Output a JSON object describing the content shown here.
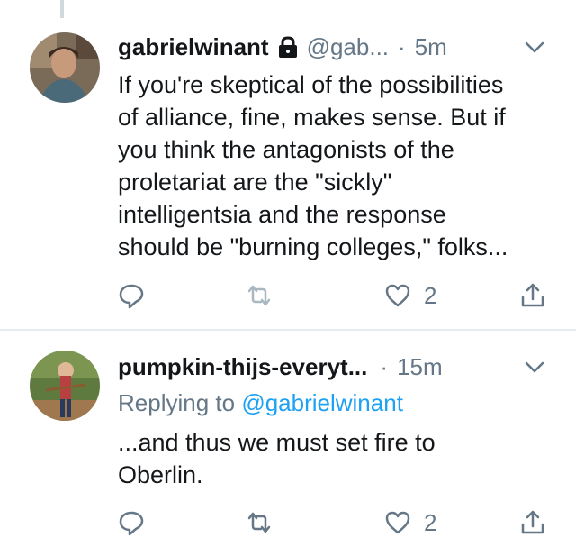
{
  "tweets": [
    {
      "display_name": "gabrielwinant",
      "handle": "@gab...",
      "separator": "·",
      "time": "5m",
      "body_lines": [
        "If you're skeptical of the possibilities",
        "of alliance, fine, makes sense. But if",
        "you think the antagonists of the",
        "proletariat are the \"sickly\"",
        "intelligentsia and the response",
        "should be \"burning colleges,\" folks..."
      ],
      "like_count": "2",
      "icons": [
        "lock-icon",
        "chevron-down-icon",
        "reply-icon",
        "retweet-icon",
        "like-icon",
        "share-icon"
      ]
    },
    {
      "display_name": "pumpkin-thijs-everyt...",
      "separator": "·",
      "time": "15m",
      "replying_to_label": "Replying to",
      "replying_to_mention": "@gabrielwinant",
      "body_lines": [
        "...and thus we must set fire to",
        "Oberlin."
      ],
      "like_count": "2",
      "icons": [
        "chevron-down-icon",
        "reply-icon",
        "retweet-icon",
        "like-icon",
        "share-icon"
      ]
    }
  ],
  "colors": {
    "text": "#14171a",
    "secondary": "#657786",
    "link": "#1da1f2",
    "divider": "#e6ecf0",
    "disabled_icon": "#aab8c2"
  }
}
